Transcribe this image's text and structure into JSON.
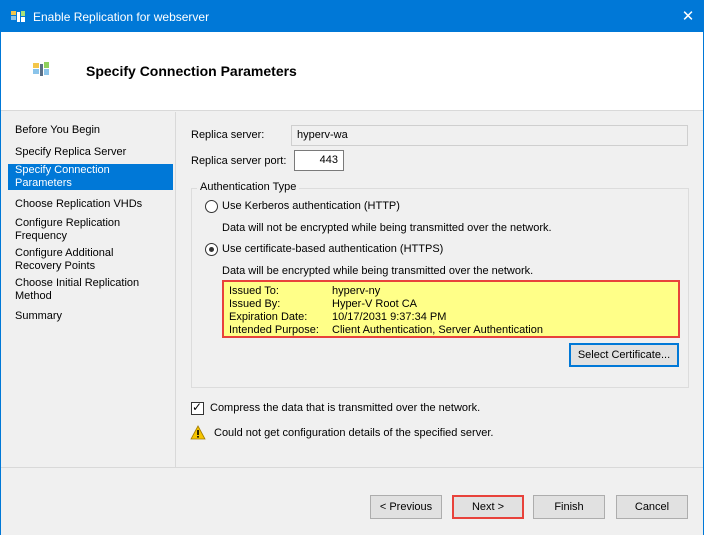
{
  "window": {
    "title": "Enable Replication for webserver",
    "close_glyph": "✕",
    "accent_color": "#0078d7"
  },
  "header": {
    "title": "Specify Connection Parameters",
    "icon": "replication-wizard-icon"
  },
  "sidebar": {
    "items": [
      {
        "line1": "Before You Begin",
        "line2": ""
      },
      {
        "line1": "Specify Replica Server",
        "line2": ""
      },
      {
        "line1": "Specify Connection",
        "line2": "Parameters"
      },
      {
        "line1": "Choose Replication VHDs",
        "line2": ""
      },
      {
        "line1": "Configure Replication",
        "line2": "Frequency"
      },
      {
        "line1": "Configure Additional",
        "line2": "Recovery Points"
      },
      {
        "line1": "Choose Initial Replication",
        "line2": "Method"
      },
      {
        "line1": "Summary",
        "line2": ""
      }
    ],
    "active_index": 2
  },
  "form": {
    "replica_server_label": "Replica server:",
    "replica_server_value": "hyperv-wa",
    "replica_port_label": "Replica server port:",
    "replica_port_value": "443",
    "auth_group_title": "Authentication Type",
    "kerberos_label": "Use Kerberos authentication (HTTP)",
    "kerberos_desc": "Data will not be encrypted while being transmitted over the network.",
    "cert_label": "Use certificate-based authentication (HTTPS)",
    "cert_desc": "Data will be encrypted while being transmitted over the network.",
    "selected_auth": "certificate",
    "certificate": {
      "issued_to_label": "Issued To:",
      "issued_to_value": "hyperv-ny",
      "issued_by_label": "Issued By:",
      "issued_by_value": "Hyper-V Root CA",
      "expiration_label": "Expiration Date:",
      "expiration_value": "10/17/2031 9:37:34 PM",
      "purpose_label": "Intended Purpose:",
      "purpose_value": "Client Authentication, Server Authentication",
      "highlight_color": "#ffff88",
      "border_color": "#e8423b"
    },
    "select_certificate_label": "Select Certificate...",
    "compress_label": "Compress the data that is transmitted over the network.",
    "compress_checked": true,
    "warning_text": "Could not get configuration details of the specified server."
  },
  "footer": {
    "previous_label": "< Previous",
    "next_label": "Next >",
    "finish_label": "Finish",
    "cancel_label": "Cancel"
  }
}
